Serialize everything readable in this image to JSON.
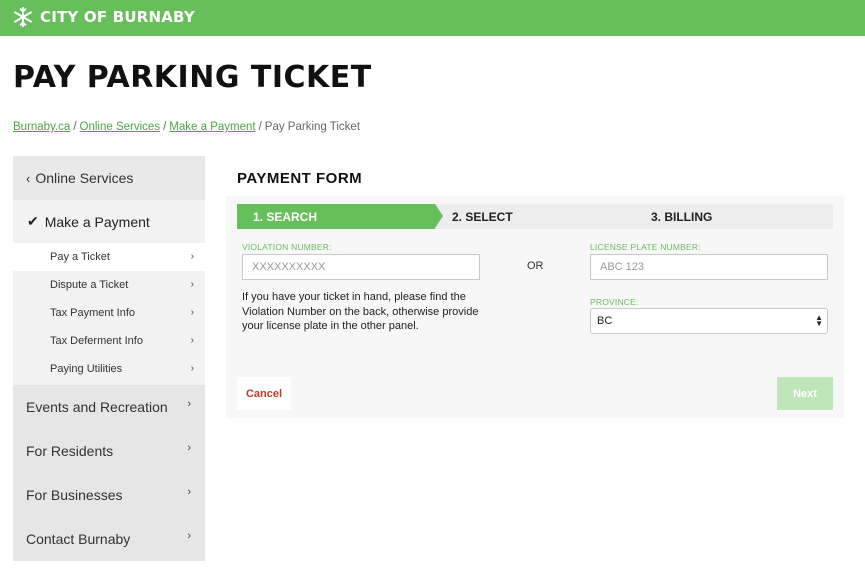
{
  "header": {
    "logo_text": "CITY OF BURNABY",
    "logo_icon": "snowflake-logo-icon",
    "brand_color": "#67bf5c"
  },
  "page": {
    "title": "PAY PARKING TICKET"
  },
  "breadcrumb": {
    "items": [
      "Burnaby.ca",
      "Online Services",
      "Make a Payment"
    ],
    "current": "Pay Parking Ticket",
    "separator": "/"
  },
  "sidebar": {
    "back_label": "Online Services",
    "current_section": "Make a Payment",
    "sub_items": [
      "Pay a Ticket",
      "Dispute a Ticket",
      "Tax Payment Info",
      "Tax Deferment Info",
      "Paying Utilities"
    ],
    "active_sub_item": "Pay a Ticket",
    "groups": [
      "Events and Recreation",
      "For Residents",
      "For Businesses",
      "Contact Burnaby"
    ]
  },
  "form": {
    "title": "PAYMENT FORM",
    "steps": [
      "1. SEARCH",
      "2. SELECT",
      "3. BILLING"
    ],
    "active_step": "1. SEARCH",
    "violation_label": "VIOLATION NUMBER:",
    "violation_placeholder": "XXXXXXXXXX",
    "or_label": "OR",
    "help_text": "If you have your ticket in hand, please find the Violation Number on the back, otherwise provide your license plate in the other panel.",
    "plate_label": "LICENSE PLATE NUMBER:",
    "plate_placeholder": "ABC 123",
    "province_label": "PROVINCE:",
    "province_value": "BC",
    "cancel_label": "Cancel",
    "next_label": "Next",
    "cancel_color": "#c0392b",
    "next_color": "#bfe6b9"
  }
}
